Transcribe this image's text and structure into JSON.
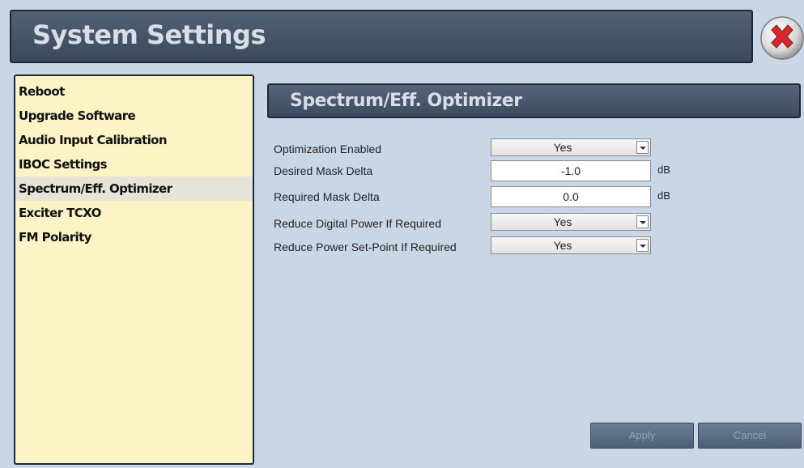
{
  "window": {
    "title": "System Settings"
  },
  "sidebar": {
    "items": [
      {
        "label": "Reboot"
      },
      {
        "label": "Upgrade Software"
      },
      {
        "label": "Audio Input Calibration"
      },
      {
        "label": "IBOC Settings"
      },
      {
        "label": "Spectrum/Eff. Optimizer",
        "selected": true
      },
      {
        "label": "Exciter TCXO"
      },
      {
        "label": "FM Polarity"
      }
    ]
  },
  "panel": {
    "title": "Spectrum/Eff. Optimizer",
    "fields": [
      {
        "label": "Optimization Enabled",
        "type": "select",
        "value": "Yes"
      },
      {
        "label": "Desired Mask Delta",
        "type": "text",
        "value": "-1.0",
        "unit": "dB"
      },
      {
        "label": "Required Mask Delta",
        "type": "text",
        "value": "0.0",
        "unit": "dB"
      },
      {
        "label": "Reduce Digital Power If Required",
        "type": "select",
        "value": "Yes"
      },
      {
        "label": "Reduce Power Set-Point If Required",
        "type": "select",
        "value": "Yes"
      }
    ],
    "buttons": {
      "apply": "Apply",
      "cancel": "Cancel"
    }
  },
  "icons": {
    "close": "close-icon"
  },
  "colors": {
    "header_bg": "#3b495c",
    "sidebar_bg": "#fdf4c6",
    "page_bg": "#c9d6e6",
    "close_red": "#d62828"
  }
}
